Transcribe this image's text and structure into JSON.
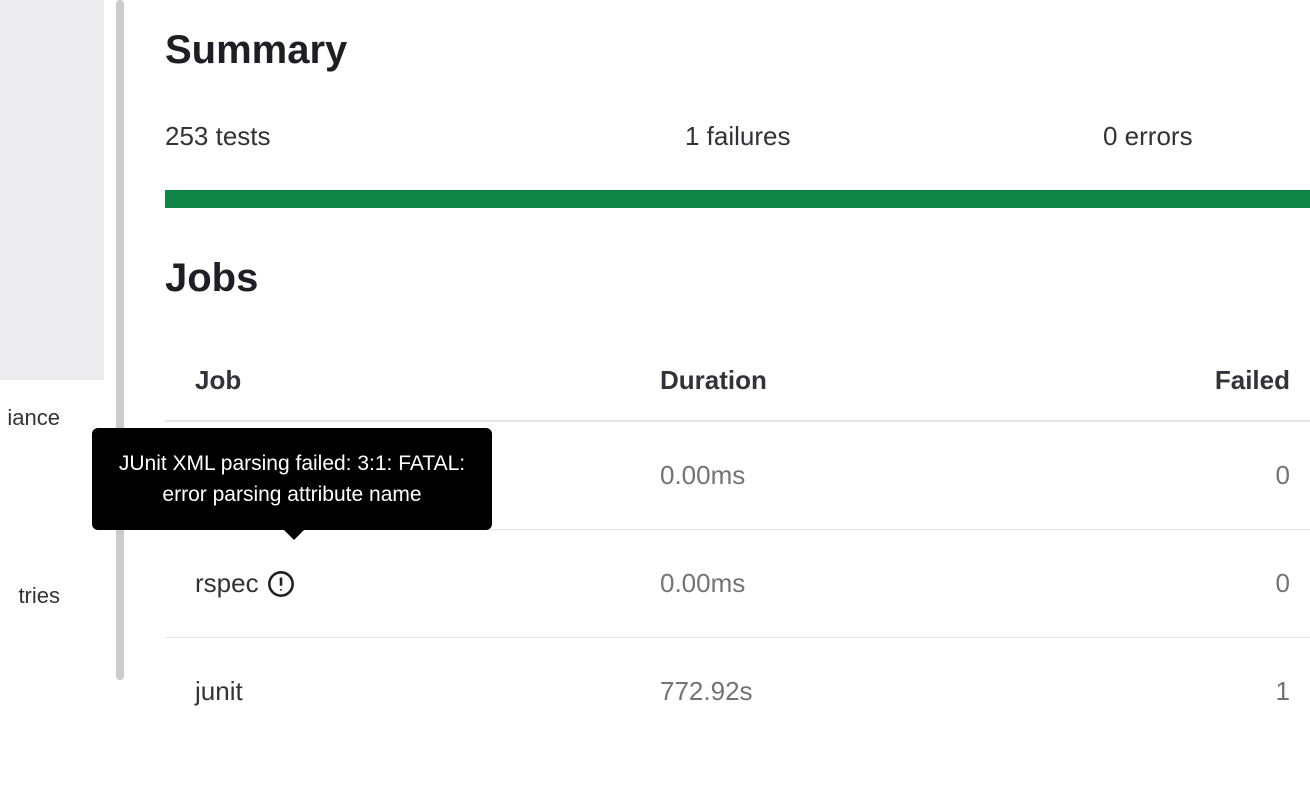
{
  "sidebar": {
    "items": [
      {
        "label": "iance"
      },
      {
        "label": "tries"
      }
    ]
  },
  "summary": {
    "title": "Summary",
    "tests": "253 tests",
    "failures": "1 failures",
    "errors": "0 errors"
  },
  "jobs": {
    "title": "Jobs",
    "columns": {
      "job": "Job",
      "duration": "Duration",
      "failed": "Failed"
    },
    "rows": [
      {
        "name": "",
        "duration": "0.00ms",
        "failed": "0",
        "has_error": false
      },
      {
        "name": "rspec",
        "duration": "0.00ms",
        "failed": "0",
        "has_error": true
      },
      {
        "name": "junit",
        "duration": "772.92s",
        "failed": "1",
        "has_error": false
      }
    ]
  },
  "tooltip": {
    "text": "JUnit XML parsing failed: 3:1: FATAL: error parsing attribute name"
  }
}
